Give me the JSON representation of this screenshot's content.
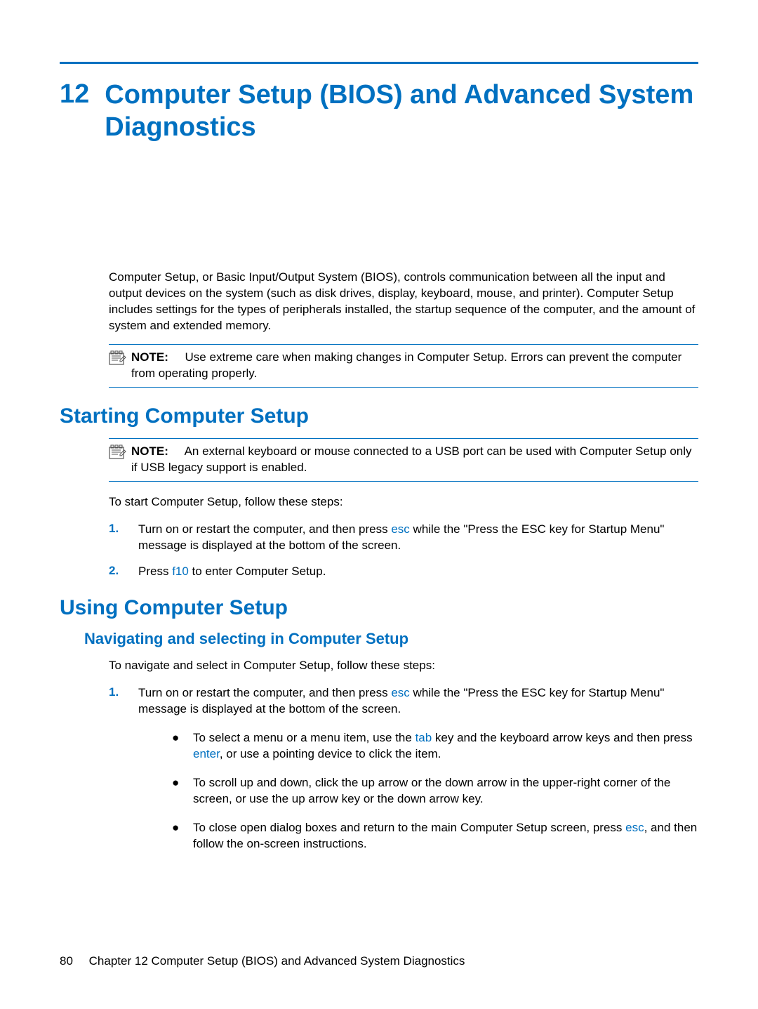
{
  "chapter": {
    "number": "12",
    "title": "Computer Setup (BIOS) and Advanced System Diagnostics"
  },
  "intro": "Computer Setup, or Basic Input/Output System (BIOS), controls communication between all the input and output devices on the system (such as disk drives, display, keyboard, mouse, and printer). Computer Setup includes settings for the types of peripherals installed, the startup sequence of the computer, and the amount of system and extended memory.",
  "note1": {
    "label": "NOTE:",
    "text": "Use extreme care when making changes in Computer Setup. Errors can prevent the computer from operating properly."
  },
  "section1": {
    "heading": "Starting Computer Setup",
    "note": {
      "label": "NOTE:",
      "text": "An external keyboard or mouse connected to a USB port can be used with Computer Setup only if USB legacy support is enabled."
    },
    "para": "To start Computer Setup, follow these steps:",
    "steps": {
      "s1_num": "1.",
      "s1_pre": "Turn on or restart the computer, and then press ",
      "s1_key": "esc",
      "s1_post": " while the \"Press the ESC key for Startup Menu\" message is displayed at the bottom of the screen.",
      "s2_num": "2.",
      "s2_pre": "Press ",
      "s2_key": "f10",
      "s2_post": " to enter Computer Setup."
    }
  },
  "section2": {
    "heading": "Using Computer Setup",
    "sub1": {
      "heading": "Navigating and selecting in Computer Setup",
      "para": "To navigate and select in Computer Setup, follow these steps:",
      "s1_num": "1.",
      "s1_pre": "Turn on or restart the computer, and then press ",
      "s1_key": "esc",
      "s1_post": " while the \"Press the ESC key for Startup Menu\" message is displayed at the bottom of the screen.",
      "b1_pre": "To select a menu or a menu item, use the ",
      "b1_key1": "tab",
      "b1_mid": " key and the keyboard arrow keys and then press ",
      "b1_key2": "enter",
      "b1_post": ", or use a pointing device to click the item.",
      "b2": "To scroll up and down, click the up arrow or the down arrow in the upper-right corner of the screen, or use the up arrow key or the down arrow key.",
      "b3_pre": "To close open dialog boxes and return to the main Computer Setup screen, press ",
      "b3_key": "esc",
      "b3_post": ", and then follow the on-screen instructions."
    }
  },
  "footer": {
    "page": "80",
    "text": "Chapter 12   Computer Setup (BIOS) and Advanced System Diagnostics"
  }
}
